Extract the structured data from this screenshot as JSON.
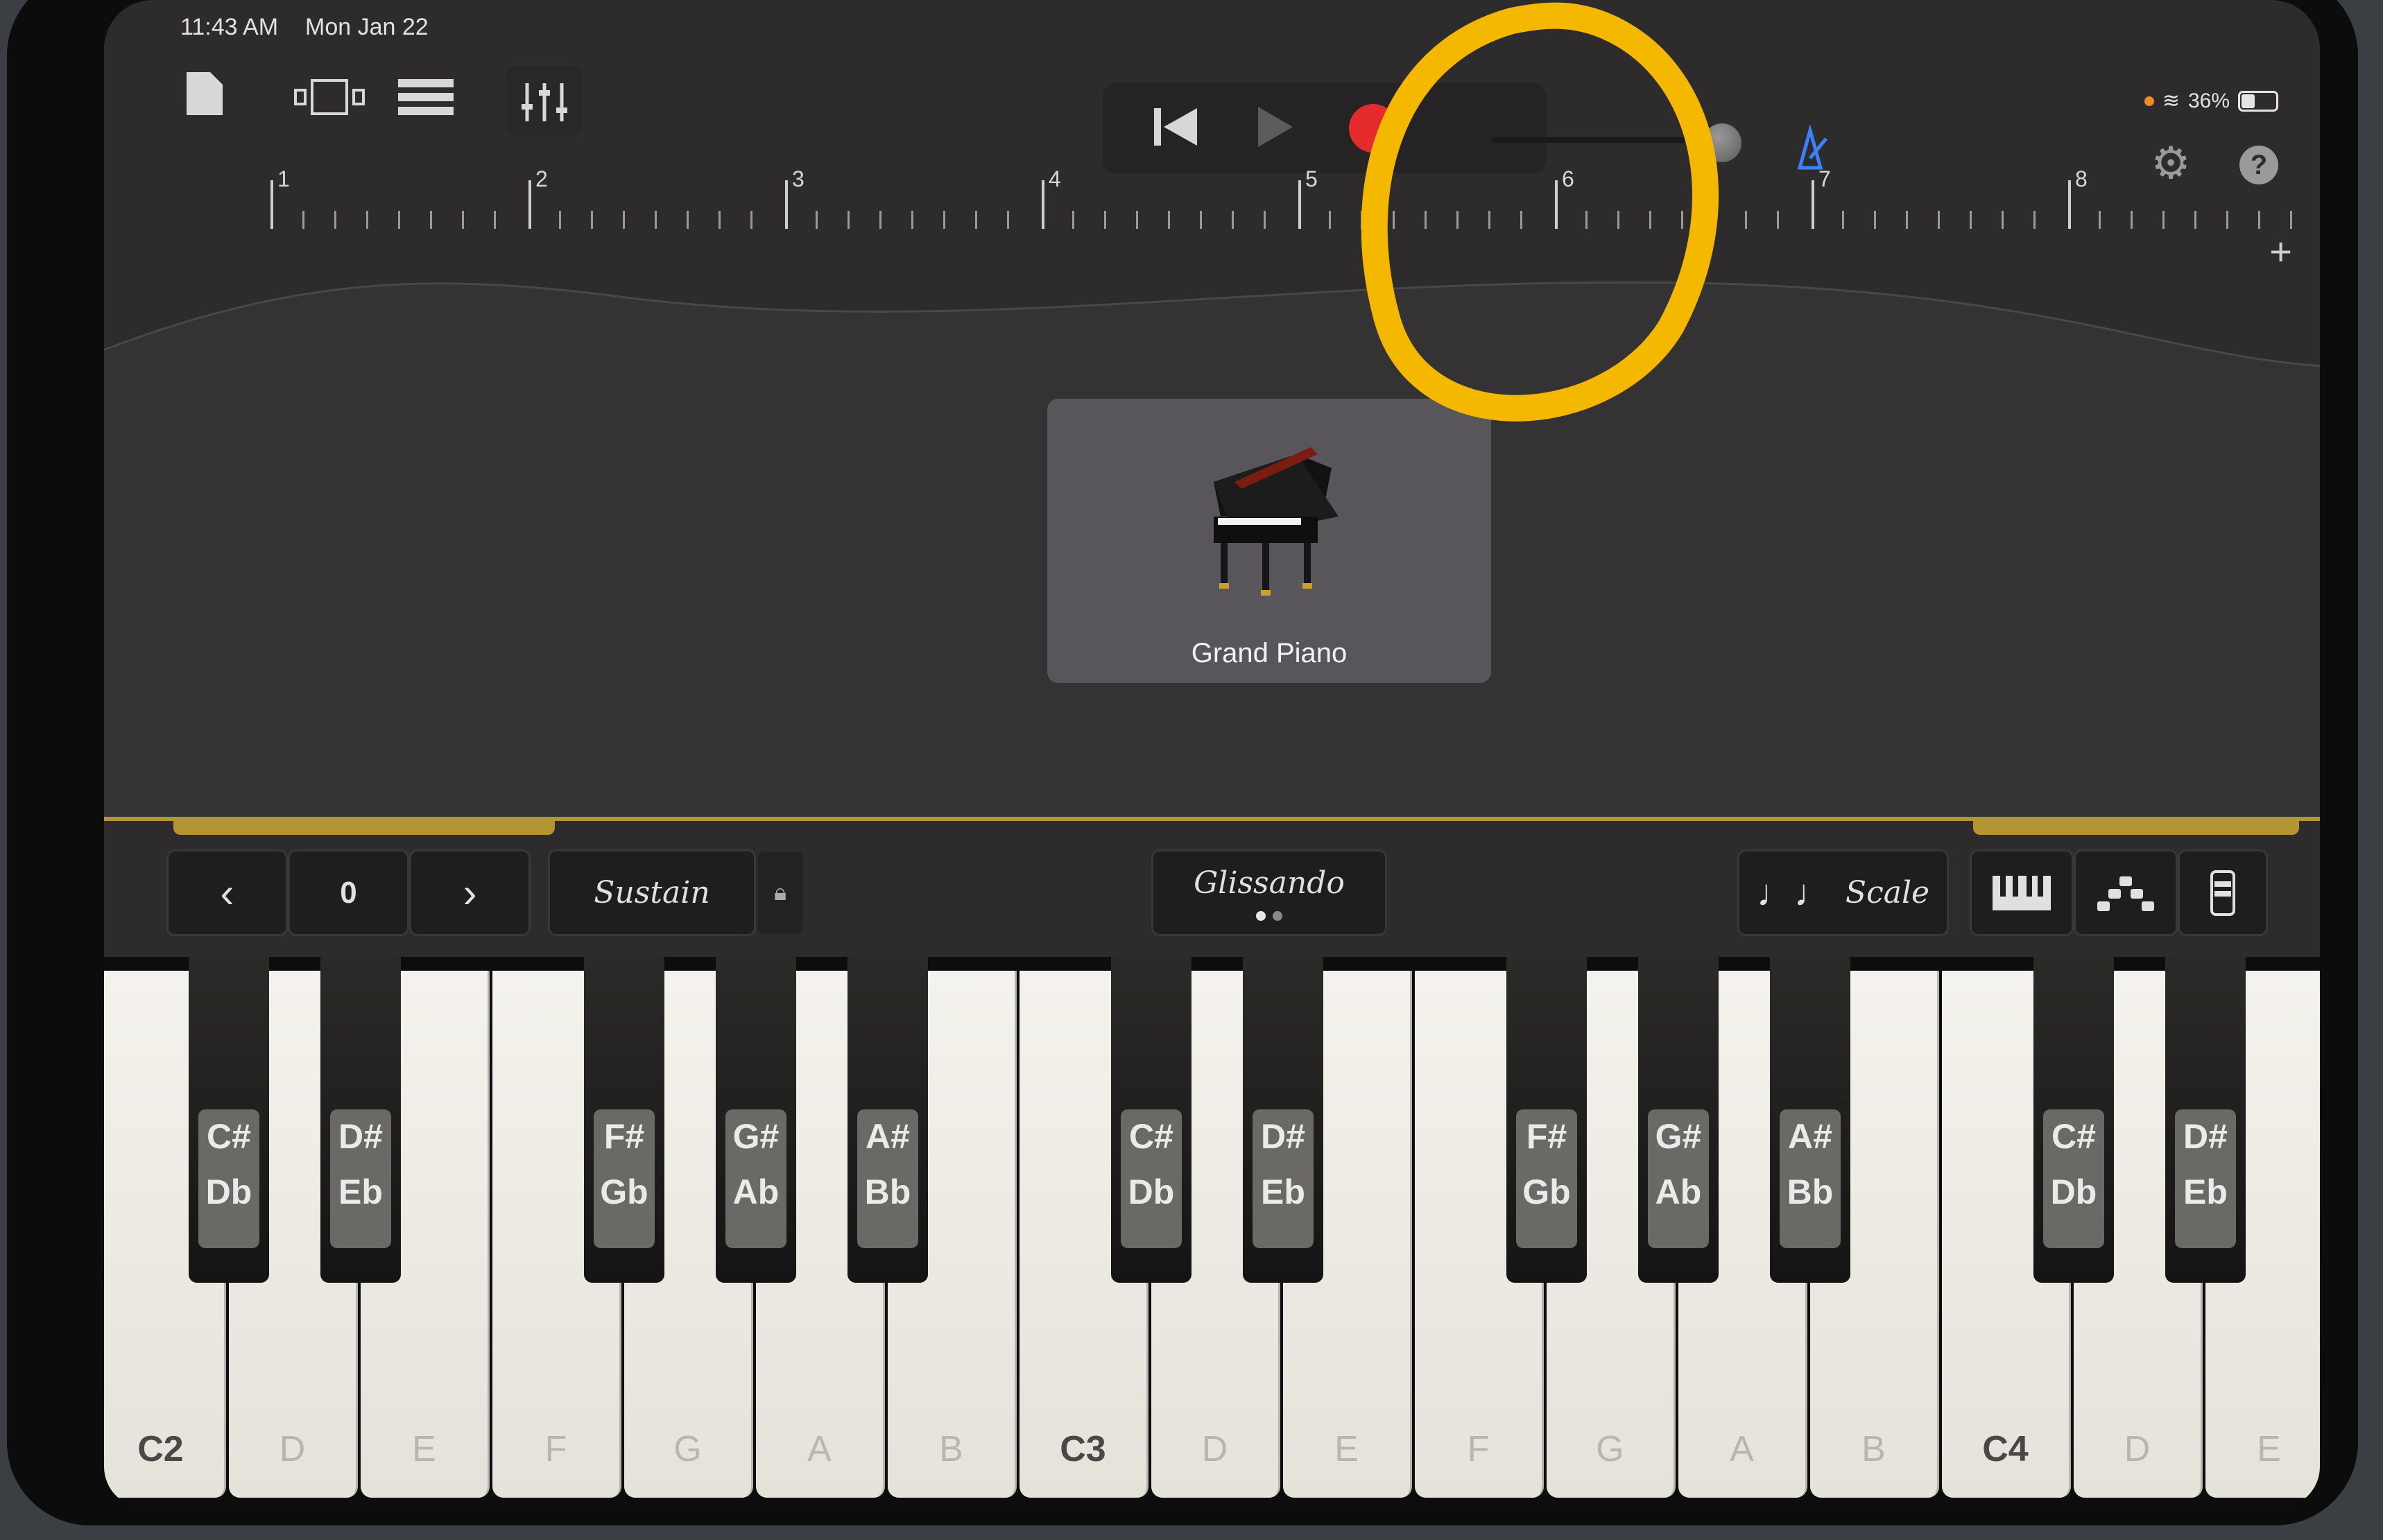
{
  "status": {
    "time": "11:43 AM",
    "date": "Mon Jan 22",
    "battery": "36%"
  },
  "ruler": {
    "bars": [
      "1",
      "2",
      "3",
      "4",
      "5",
      "6",
      "7",
      "8"
    ]
  },
  "instrument": {
    "name": "Grand Piano"
  },
  "controls": {
    "octave_value": "0",
    "sustain_label": "Sustain",
    "glissando_label": "Glissando",
    "scale_label": "Scale"
  },
  "keyboard": {
    "white_keys": [
      "C2",
      "D",
      "E",
      "F",
      "G",
      "A",
      "B",
      "C3",
      "D",
      "E",
      "F",
      "G",
      "A",
      "B",
      "C4",
      "D",
      "E"
    ],
    "black_keys": [
      {
        "top": "C#",
        "bottom": "Db"
      },
      {
        "top": "D#",
        "bottom": "Eb"
      },
      {
        "top": "F#",
        "bottom": "Gb"
      },
      {
        "top": "G#",
        "bottom": "Ab"
      },
      {
        "top": "A#",
        "bottom": "Bb"
      },
      {
        "top": "C#",
        "bottom": "Db"
      },
      {
        "top": "D#",
        "bottom": "Eb"
      },
      {
        "top": "F#",
        "bottom": "Gb"
      },
      {
        "top": "G#",
        "bottom": "Ab"
      },
      {
        "top": "A#",
        "bottom": "Bb"
      },
      {
        "top": "C#",
        "bottom": "Db"
      },
      {
        "top": "D#",
        "bottom": "Eb"
      }
    ]
  },
  "colors": {
    "record": "#e52b2b",
    "accent_gold": "#b59433",
    "annotation": "#f5b800",
    "metronome": "#3b82f6"
  },
  "icons": [
    "document-icon",
    "view-toggle-icon",
    "tracks-icon",
    "mixer-icon",
    "rewind-icon",
    "play-icon",
    "record-icon",
    "volume-knob",
    "metronome-icon",
    "settings-icon",
    "help-icon",
    "grand-piano-icon",
    "chevron-left-icon",
    "chevron-right-icon",
    "lock-icon",
    "notes-icon",
    "keyboard-layout-icon",
    "arpeggiator-icon",
    "fader-icon"
  ]
}
